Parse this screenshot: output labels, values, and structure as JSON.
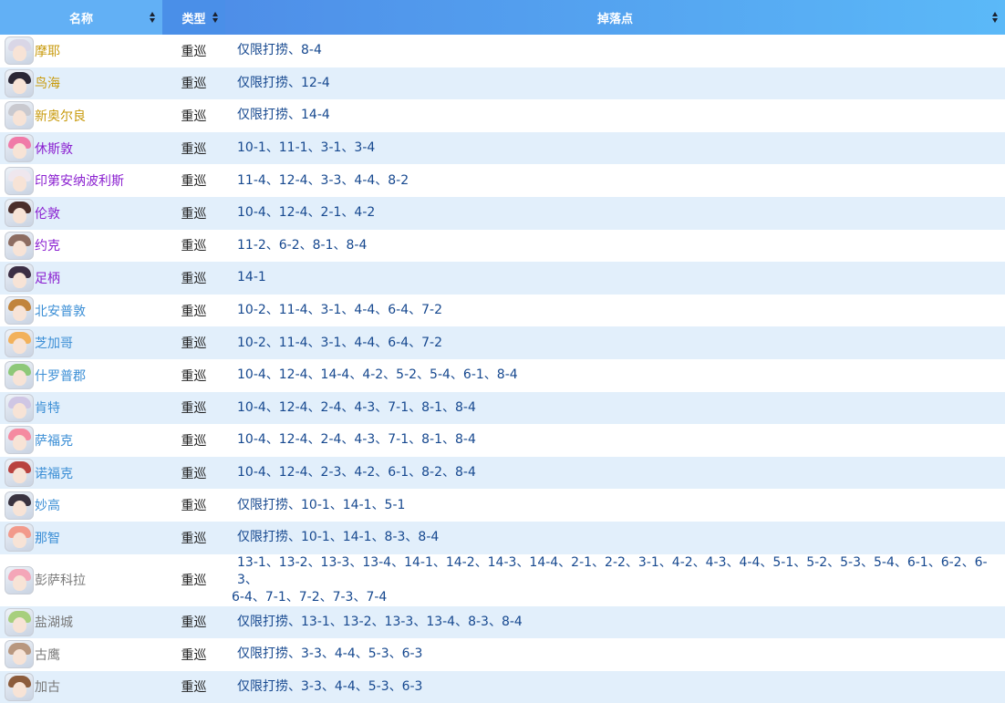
{
  "headers": {
    "name": "名称",
    "type": "类型",
    "drops": "掉落点"
  },
  "rarity_colors": {
    "super_rare": "#c89a0c",
    "elite": "#8a1fd0",
    "rare": "#3c8fd6",
    "common": "#7a7a7a"
  },
  "rows": [
    {
      "name": "摩耶",
      "rarity": "super_rare",
      "hair": "#d9d6e6",
      "type": "重巡",
      "drops": "仅限打捞、8-4"
    },
    {
      "name": "鸟海",
      "rarity": "super_rare",
      "hair": "#2b2735",
      "type": "重巡",
      "drops": "仅限打捞、12-4"
    },
    {
      "name": "新奥尔良",
      "rarity": "super_rare",
      "hair": "#c9c9cf",
      "type": "重巡",
      "drops": "仅限打捞、14-4"
    },
    {
      "name": "休斯敦",
      "rarity": "elite",
      "hair": "#f07aa8",
      "type": "重巡",
      "drops": "10-1、11-1、3-1、3-4"
    },
    {
      "name": "印第安纳波利斯",
      "rarity": "elite",
      "hair": "#efe7ee",
      "type": "重巡",
      "drops": "11-4、12-4、3-3、4-4、8-2"
    },
    {
      "name": "伦敦",
      "rarity": "elite",
      "hair": "#4b2e2a",
      "type": "重巡",
      "drops": "10-4、12-4、2-1、4-2"
    },
    {
      "name": "约克",
      "rarity": "elite",
      "hair": "#8d6d62",
      "type": "重巡",
      "drops": "11-2、6-2、8-1、8-4"
    },
    {
      "name": "足柄",
      "rarity": "elite",
      "hair": "#3c2f45",
      "type": "重巡",
      "drops": "14-1"
    },
    {
      "name": "北安普敦",
      "rarity": "rare",
      "hair": "#c1843c",
      "type": "重巡",
      "drops": "10-2、11-4、3-1、4-4、6-4、7-2"
    },
    {
      "name": "芝加哥",
      "rarity": "rare",
      "hair": "#f2b15b",
      "type": "重巡",
      "drops": "10-2、11-4、3-1、4-4、6-4、7-2"
    },
    {
      "name": "什罗普郡",
      "rarity": "rare",
      "hair": "#8ec879",
      "type": "重巡",
      "drops": "10-4、12-4、14-4、4-2、5-2、5-4、6-1、8-4"
    },
    {
      "name": "肯特",
      "rarity": "rare",
      "hair": "#cfc6e4",
      "type": "重巡",
      "drops": "10-4、12-4、2-4、4-3、7-1、8-1、8-4"
    },
    {
      "name": "萨福克",
      "rarity": "rare",
      "hair": "#f58aa0",
      "type": "重巡",
      "drops": "10-4、12-4、2-4、4-3、7-1、8-1、8-4"
    },
    {
      "name": "诺福克",
      "rarity": "rare",
      "hair": "#b9423f",
      "type": "重巡",
      "drops": "10-4、12-4、2-3、4-2、6-1、8-2、8-4"
    },
    {
      "name": "妙高",
      "rarity": "rare",
      "hair": "#3a3340",
      "type": "重巡",
      "drops": "仅限打捞、10-1、14-1、5-1"
    },
    {
      "name": "那智",
      "rarity": "rare",
      "hair": "#f29a8b",
      "type": "重巡",
      "drops": "仅限打捞、10-1、14-1、8-3、8-4"
    },
    {
      "name": "彭萨科拉",
      "rarity": "common",
      "hair": "#f4a6b8",
      "type": "重巡",
      "drops": "13-1、13-2、13-3、13-4、14-1、14-2、14-3、14-4、2-1、2-2、3-1、4-2、4-3、4-4、5-1、5-2、5-3、5-4、6-1、6-2、6-3、",
      "drops2": "6-4、7-1、7-2、7-3、7-4"
    },
    {
      "name": "盐湖城",
      "rarity": "common",
      "hair": "#a7cf7d",
      "type": "重巡",
      "drops": "仅限打捞、13-1、13-2、13-3、13-4、8-3、8-4"
    },
    {
      "name": "古鹰",
      "rarity": "common",
      "hair": "#b8977f",
      "type": "重巡",
      "drops": "仅限打捞、3-3、4-4、5-3、6-3"
    },
    {
      "name": "加古",
      "rarity": "common",
      "hair": "#8c5c3c",
      "type": "重巡",
      "drops": "仅限打捞、3-3、4-4、5-3、6-3"
    }
  ]
}
